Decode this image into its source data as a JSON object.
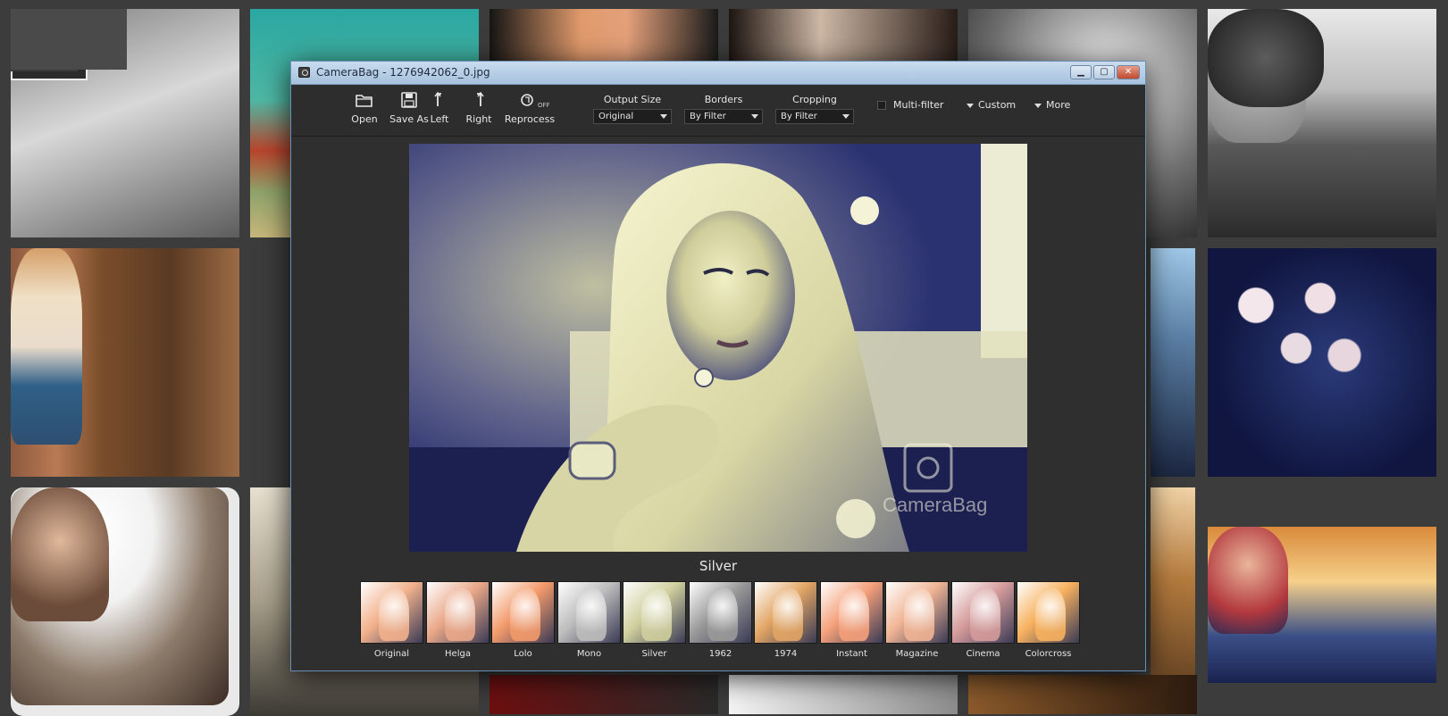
{
  "window": {
    "title": "CameraBag - 1276942062_0.jpg",
    "controls": {
      "minimize": "▁",
      "maximize": "▢",
      "close": "✕"
    }
  },
  "toolbar": {
    "buttons": [
      {
        "label": "Open",
        "icon": "folder-open-icon"
      },
      {
        "label": "Save As",
        "icon": "floppy-disk-icon"
      },
      {
        "label": "Left",
        "icon": "rotate-left-icon"
      },
      {
        "label": "Right",
        "icon": "rotate-right-icon"
      },
      {
        "label": "Reprocess",
        "icon": "reprocess-icon",
        "badge": "OFF"
      }
    ],
    "dropdowns": [
      {
        "label": "Output Size",
        "value": "Original"
      },
      {
        "label": "Borders",
        "value": "By Filter"
      },
      {
        "label": "Cropping",
        "value": "By Filter"
      }
    ],
    "multifilter_label": "Multi-filter",
    "custom_label": "Custom",
    "more_label": "More"
  },
  "preview": {
    "watermark": "CameraBag",
    "filter_name": "Silver"
  },
  "filters": [
    {
      "label": "Original",
      "tint": "#f2b18c"
    },
    {
      "label": "Helga",
      "tint": "#eaa889"
    },
    {
      "label": "Lolo",
      "tint": "#f39a6b"
    },
    {
      "label": "Mono",
      "tint": "#bdbdbd"
    },
    {
      "label": "Silver",
      "tint": "#cfcf9e"
    },
    {
      "label": "1962",
      "tint": "#9a9a9a"
    },
    {
      "label": "1974",
      "tint": "#e2a564"
    },
    {
      "label": "Instant",
      "tint": "#f5a07a"
    },
    {
      "label": "Magazine",
      "tint": "#f0b494"
    },
    {
      "label": "Cinema",
      "tint": "#d59b9b"
    },
    {
      "label": "Colorcross",
      "tint": "#f7b15f"
    }
  ],
  "colors": {
    "window_bg": "#2f2f2f",
    "titlebar": "#b9cfe6",
    "preview_ink": "#2a3170",
    "preview_light": "#e9e8b4"
  }
}
